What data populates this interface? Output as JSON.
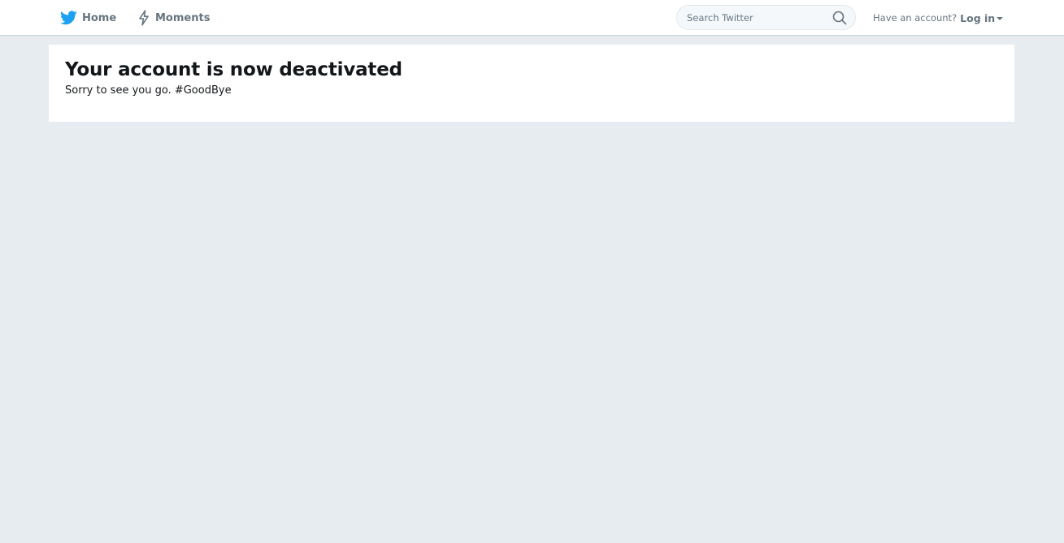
{
  "nav": {
    "home_label": "Home",
    "moments_label": "Moments",
    "home_icon": "twitter-bird-icon",
    "moments_icon": "lightning-bolt-icon"
  },
  "search": {
    "placeholder": "Search Twitter",
    "icon": "search-icon"
  },
  "account": {
    "prompt": "Have an account?",
    "login_label": "Log in"
  },
  "main": {
    "title": "Your account is now deactivated",
    "message": "Sorry to see you go. #GoodBye"
  },
  "colors": {
    "background": "#e6ecf0",
    "brand_blue": "#1da1f2",
    "nav_text": "#66757f",
    "heading_text": "#14171a"
  }
}
